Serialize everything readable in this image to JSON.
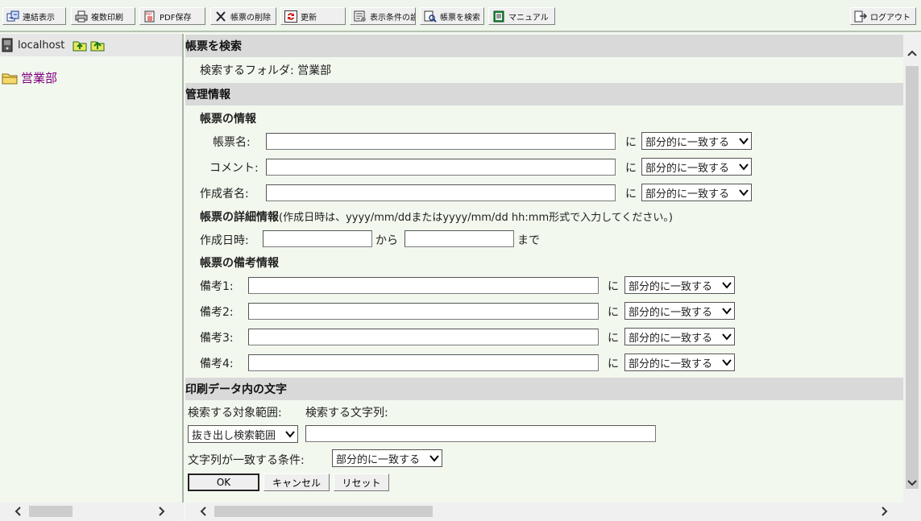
{
  "toolbar": {
    "buttons": [
      {
        "label": "連結表示",
        "icon": "link-view-icon"
      },
      {
        "label": "複数印刷",
        "icon": "printer-icon"
      },
      {
        "label": "PDF保存",
        "icon": "pdf-icon"
      },
      {
        "label": "帳票の削除",
        "icon": "delete-x-icon"
      },
      {
        "label": "更新",
        "icon": "refresh-icon"
      },
      {
        "label": "表示条件の設定",
        "icon": "display-settings-icon"
      },
      {
        "label": "帳票を検索",
        "icon": "search-forms-icon"
      },
      {
        "label": "マニュアル",
        "icon": "manual-book-icon"
      }
    ],
    "logout_label": "ログアウト"
  },
  "sidebar": {
    "server": "localhost",
    "folder": "営業部"
  },
  "search": {
    "title": "帳票を検索",
    "folder_label": "検索するフォルダ: 営業部"
  },
  "management": {
    "title": "管理情報",
    "form_info_title": "帳票の情報",
    "fields": [
      {
        "label": "帳票名:",
        "value": ""
      },
      {
        "label": "コメント:",
        "value": ""
      },
      {
        "label": "作成者名:",
        "value": ""
      }
    ],
    "ni": "に",
    "match_option": "部分的に一致する",
    "detail_title": "帳票の詳細情報",
    "detail_note": "(作成日時は、yyyy/mm/ddまたはyyyy/mm/dd hh:mm形式で入力してください。)",
    "created_label": "作成日時:",
    "from_label": "から",
    "until_label": "まで",
    "remarks_title": "帳票の備考情報",
    "remarks": [
      {
        "label": "備考1:"
      },
      {
        "label": "備考2:"
      },
      {
        "label": "備考3:"
      },
      {
        "label": "備考4:"
      }
    ]
  },
  "print_text": {
    "title": "印刷データ内の文字",
    "range_label": "検索する対象範囲:",
    "string_label": "検索する文字列:",
    "range_option": "抜き出し検索範囲",
    "condition_label": "文字列が一致する条件:",
    "condition_option": "部分的に一致する"
  },
  "buttons": {
    "ok": "OK",
    "cancel": "キャンセル",
    "reset": "リセット"
  }
}
